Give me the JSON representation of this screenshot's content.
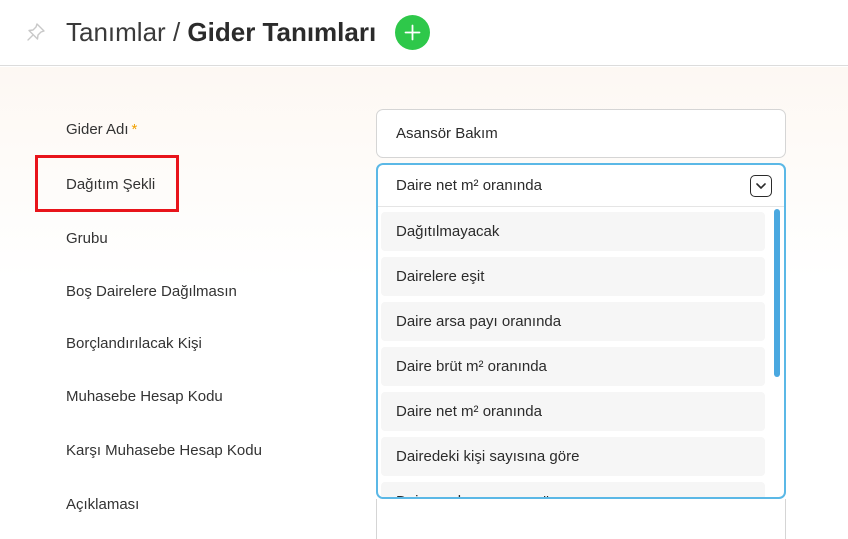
{
  "header": {
    "breadcrumb_parent": "Tanımlar",
    "separator": "/",
    "title": "Gider Tanımları",
    "pin_icon": "pin-icon",
    "add_icon": "plus-icon",
    "add_color": "#2ec84a"
  },
  "form": {
    "labels": {
      "expense_name": "Gider Adı",
      "required_mark": "*",
      "distribution": "Dağıtım Şekli",
      "group": "Grubu",
      "skip_empty": "Boş Dairelere Dağılmasın",
      "debtor": "Borçlandırılacak Kişi",
      "account_code": "Muhasebe Hesap Kodu",
      "counter_account_code": "Karşı Muhasebe Hesap Kodu",
      "description": "Açıklaması"
    },
    "expense_name_value": "Asansör Bakım",
    "distribution_selected": "Daire net m² oranında",
    "distribution_options": [
      "Dağıtılmayacak",
      "Dairelere eşit",
      "Daire arsa payı oranında",
      "Daire brüt m² oranında",
      "Daire net m² oranında",
      "Dairedeki kişi sayısına göre",
      "Daire grubu oranına göre"
    ]
  },
  "colors": {
    "accent": "#5bb8e6",
    "highlight": "#e8141b",
    "required": "#f0a000"
  }
}
